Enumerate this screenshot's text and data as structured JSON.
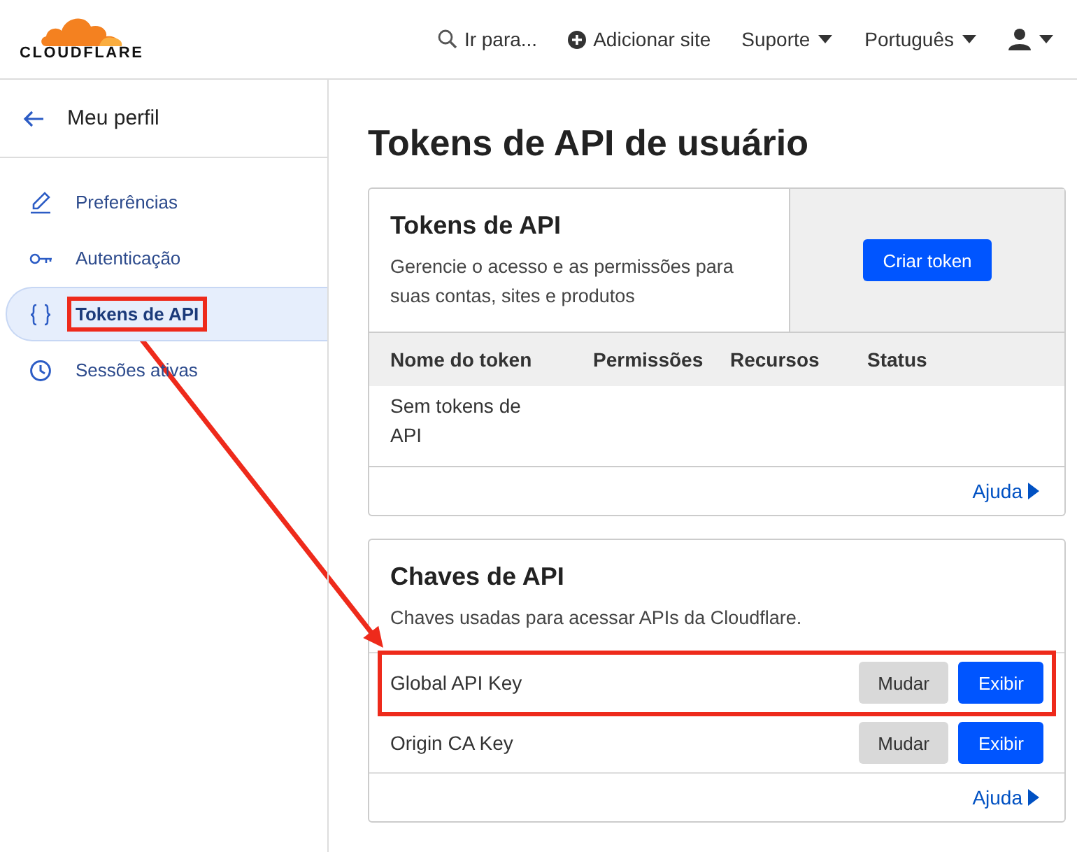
{
  "logo": {
    "text": "CLOUDFLARE"
  },
  "topnav": [
    {
      "kind": "search",
      "label": "Ir para..."
    },
    {
      "kind": "add",
      "label": "Adicionar site"
    },
    {
      "kind": "menu",
      "label": "Suporte"
    },
    {
      "kind": "menu",
      "label": "Português"
    },
    {
      "kind": "user"
    }
  ],
  "sidebar": {
    "title": "Meu perfil",
    "items": [
      {
        "label": "Preferências",
        "selected": false,
        "highlighted": false
      },
      {
        "label": "Autenticação",
        "selected": false,
        "highlighted": false
      },
      {
        "label": "Tokens de API",
        "selected": true,
        "highlighted": true
      },
      {
        "label": "Sessões ativas",
        "selected": false,
        "highlighted": false
      }
    ]
  },
  "page_title": "Tokens de API de usuário",
  "tokens_card": {
    "title": "Tokens de API",
    "description": "Gerencie o acesso e as permissões para suas contas, sites e produtos",
    "button": "Criar token",
    "columns": [
      "Nome do token",
      "Permissões",
      "Recursos",
      "Status"
    ],
    "empty_message": "Sem tokens de API",
    "help": "Ajuda"
  },
  "keys_card": {
    "title": "Chaves de API",
    "description": "Chaves usadas para acessar APIs da Cloudflare.",
    "rows": [
      {
        "name": "Global API Key",
        "change": "Mudar",
        "view": "Exibir",
        "highlighted": true
      },
      {
        "name": "Origin CA Key",
        "change": "Mudar",
        "view": "Exibir",
        "highlighted": false
      }
    ],
    "help": "Ajuda"
  }
}
